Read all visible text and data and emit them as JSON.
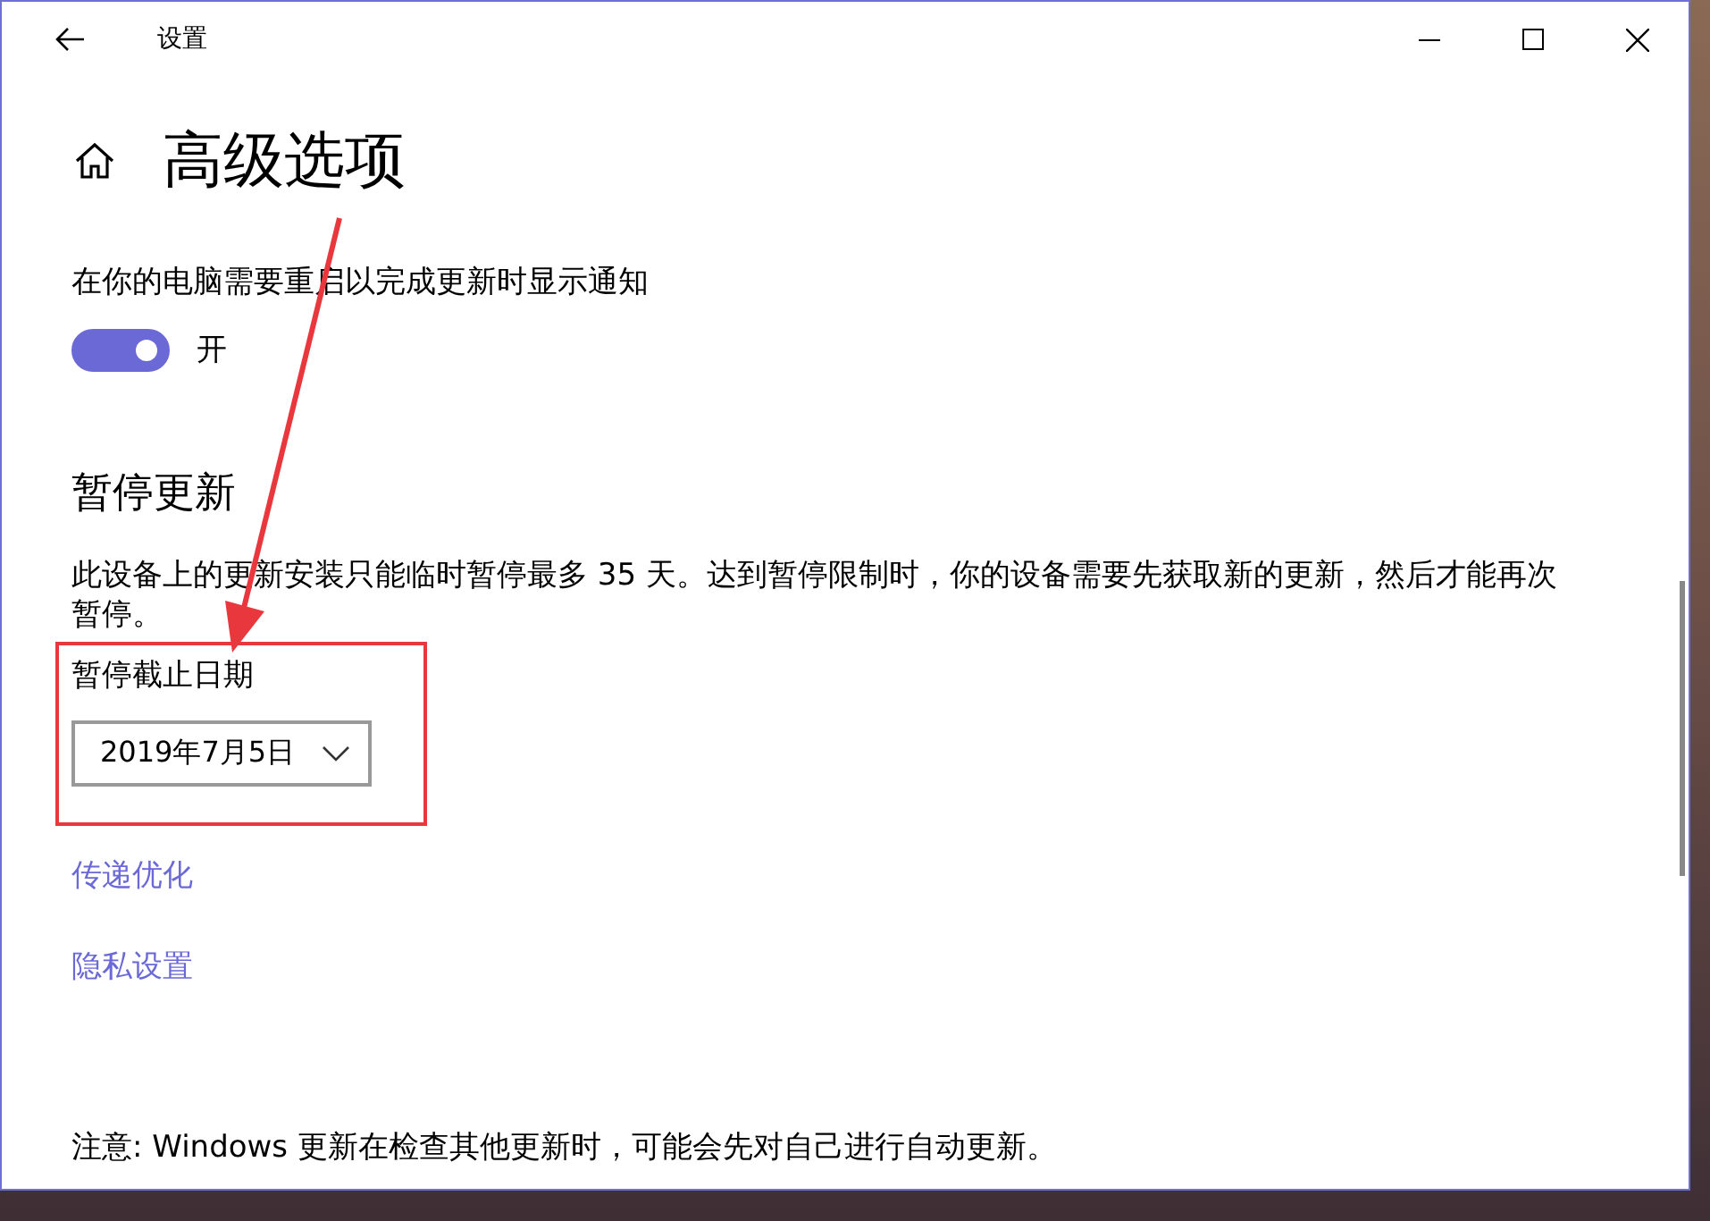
{
  "window": {
    "title": "设置"
  },
  "page": {
    "title": "高级选项"
  },
  "notification": {
    "description": "在你的电脑需要重启以完成更新时显示通知",
    "toggle": {
      "on": true,
      "label": "开"
    }
  },
  "pause": {
    "heading": "暂停更新",
    "description": "此设备上的更新安装只能临时暂停最多 35 天。达到暂停限制时，你的设备需要先获取新的更新，然后才能再次暂停。",
    "date_label": "暂停截止日期",
    "date_value": "2019年7月5日"
  },
  "links": [
    "传递优化",
    "隐私设置"
  ],
  "note": "注意: Windows 更新在检查其他更新时，可能会先对自己进行自动更新。"
}
